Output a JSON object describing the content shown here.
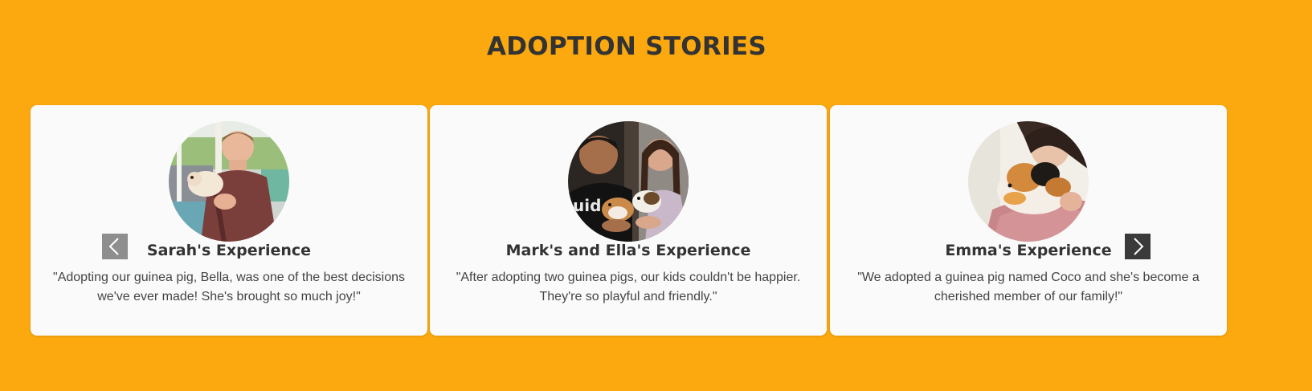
{
  "section": {
    "title": "ADOPTION STORIES"
  },
  "carousel": {
    "prev_icon": "chevron-left-icon",
    "next_icon": "chevron-right-icon",
    "stories": [
      {
        "name": "Sarah's Experience",
        "quote": "\"Adopting our guinea pig, Bella, was one of the best decisions we've ever made! She's brought so much joy!\""
      },
      {
        "name": "Mark's and Ella's Experience",
        "quote": "\"After adopting two guinea pigs, our kids couldn't be happier. They're so playful and friendly.\""
      },
      {
        "name": "Emma's Experience",
        "quote": "\"We adopted a guinea pig named Coco and she's become a cherished member of our family!\""
      }
    ]
  },
  "colors": {
    "background": "#FBA90F",
    "card": "#FAFAFA",
    "heading": "#333333",
    "prev_button": "#8E8E8E",
    "next_button": "#3A3A3A"
  }
}
